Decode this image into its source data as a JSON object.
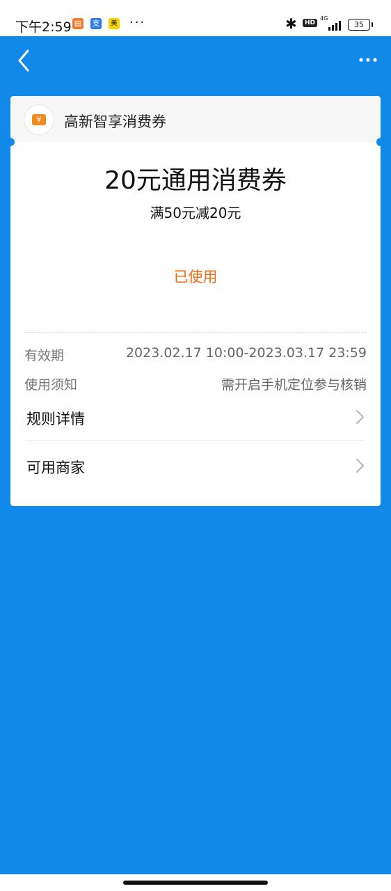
{
  "status_bar": {
    "time": "下午2:59",
    "more_dots": "···",
    "network_label": "4G",
    "hd_label": "HD",
    "battery": "35"
  },
  "colors": {
    "background": "#1189e9",
    "status_used": "#f26b0f",
    "coupon_accent": "#f28b1f"
  },
  "coupon": {
    "merchant_name": "高新智享消费券",
    "title": "20元通用消费券",
    "condition": "满50元减20元",
    "status": "已使用",
    "logo_symbol": "¥",
    "details": [
      {
        "label": "有效期",
        "value": "2023.02.17 10:00-2023.03.17 23:59"
      },
      {
        "label": "使用须知",
        "value": "需开启手机定位参与核销"
      }
    ],
    "links": [
      {
        "label": "规则详情"
      },
      {
        "label": "可用商家"
      }
    ]
  }
}
